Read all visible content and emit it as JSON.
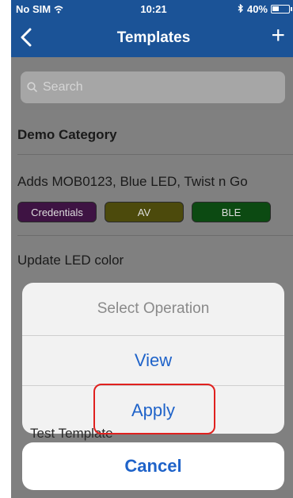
{
  "status_bar": {
    "carrier": "No SIM",
    "wifi_icon": "wifi-icon",
    "time": "10:21",
    "bluetooth_icon": "bluetooth-icon",
    "battery_percent": "40%",
    "battery_level": 0.4
  },
  "nav": {
    "title": "Templates",
    "back_icon": "chevron-left-icon",
    "add_label": "+"
  },
  "search": {
    "placeholder": "Search"
  },
  "list": {
    "section_title": "Demo Category",
    "items": [
      {
        "label": "Adds MOB0123, Blue LED, Twist n Go"
      },
      {
        "label": "Update LED color"
      }
    ],
    "tags": [
      {
        "label": "Credentials",
        "color": "#3e1343"
      },
      {
        "label": "AV",
        "color": "#4c4a0c"
      },
      {
        "label": "BLE",
        "color": "#0c4a12"
      }
    ],
    "peek_label": "Test Template"
  },
  "action_sheet": {
    "title": "Select Operation",
    "options": [
      {
        "label": "View"
      },
      {
        "label": "Apply"
      }
    ],
    "cancel_label": "Cancel"
  },
  "colors": {
    "brand": "#1b5397",
    "action": "#1f63c9",
    "highlight": "#e0211f"
  }
}
